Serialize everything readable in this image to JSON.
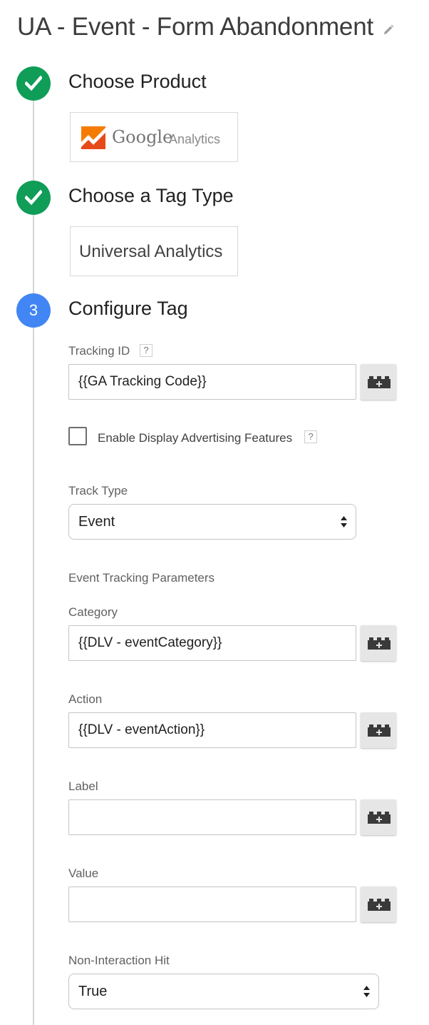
{
  "page": {
    "title": "UA - Event - Form Abandonment"
  },
  "icons": {
    "edit": "pencil-icon",
    "done": "checkmark-icon",
    "variable": "lego-block-plus-icon"
  },
  "colors": {
    "done": "#0f9d58",
    "active": "#4285f4",
    "ga_orange": "#f57c00"
  },
  "steps": [
    {
      "title": "Choose Product",
      "status": "done"
    },
    {
      "title": "Choose a Tag Type",
      "status": "done"
    },
    {
      "number": "3",
      "title": "Configure Tag",
      "status": "active"
    }
  ],
  "product": {
    "google": "Google",
    "analytics": "Analytics"
  },
  "tag_type": {
    "label": "Universal Analytics"
  },
  "config": {
    "tracking_id": {
      "label": "Tracking ID",
      "help": "?",
      "value": "{{GA Tracking Code}}"
    },
    "display_ads": {
      "label": "Enable Display Advertising Features",
      "help": "?",
      "checked": false
    },
    "track_type": {
      "label": "Track Type",
      "value": "Event"
    },
    "event_params_heading": "Event Tracking Parameters",
    "category": {
      "label": "Category",
      "value": "{{DLV - eventCategory}}"
    },
    "action": {
      "label": "Action",
      "value": "{{DLV - eventAction}}"
    },
    "event_label": {
      "label": "Label",
      "value": ""
    },
    "event_value": {
      "label": "Value",
      "value": ""
    },
    "non_interaction": {
      "label": "Non-Interaction Hit",
      "value": "True"
    }
  }
}
